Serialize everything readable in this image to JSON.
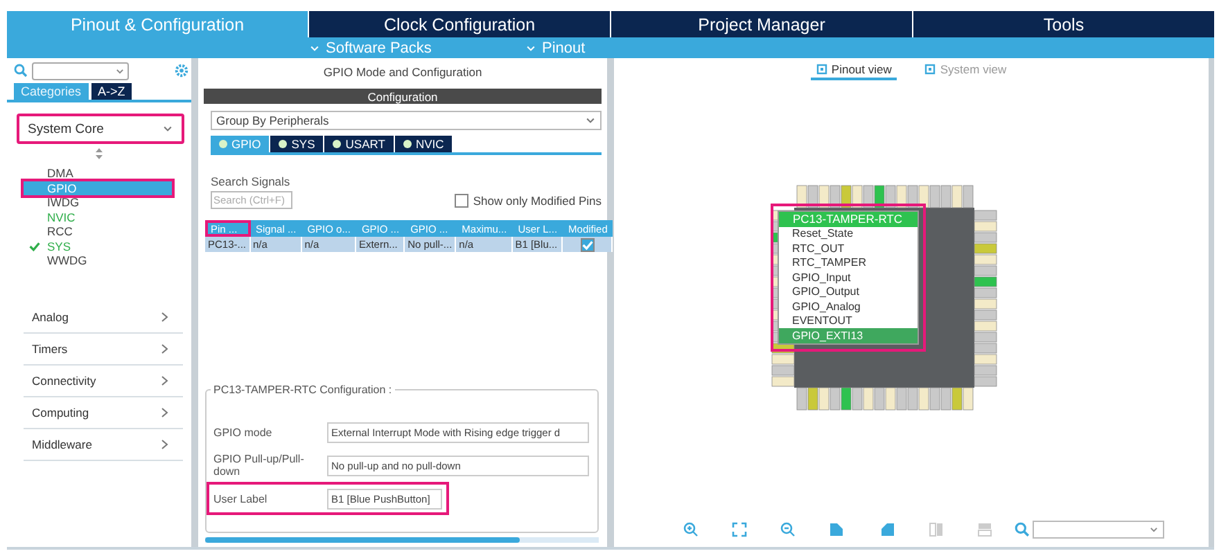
{
  "main_tabs": [
    {
      "label": "Pinout & Configuration",
      "selected": true
    },
    {
      "label": "Clock Configuration",
      "selected": false
    },
    {
      "label": "Project Manager",
      "selected": false
    },
    {
      "label": "Tools",
      "selected": false
    }
  ],
  "sub_menus": [
    {
      "label": "Software Packs"
    },
    {
      "label": "Pinout"
    }
  ],
  "sidebar": {
    "view_tabs": [
      {
        "label": "Categories",
        "selected": true
      },
      {
        "label": "A->Z",
        "selected": false
      }
    ],
    "categories": [
      {
        "label": "System Core",
        "expanded": true,
        "highlighted": true,
        "children": [
          {
            "label": "DMA",
            "selected": false,
            "configured": false,
            "checked": false,
            "highlighted": false
          },
          {
            "label": "GPIO",
            "selected": true,
            "configured": false,
            "checked": false,
            "highlighted": true
          },
          {
            "label": "IWDG",
            "selected": false,
            "configured": false,
            "checked": false,
            "highlighted": false
          },
          {
            "label": "NVIC",
            "selected": false,
            "configured": true,
            "checked": false,
            "highlighted": false
          },
          {
            "label": "RCC",
            "selected": false,
            "configured": false,
            "checked": false,
            "highlighted": false
          },
          {
            "label": "SYS",
            "selected": false,
            "configured": true,
            "checked": true,
            "highlighted": false
          },
          {
            "label": "WWDG",
            "selected": false,
            "configured": false,
            "checked": false,
            "highlighted": false
          }
        ]
      },
      {
        "label": "Analog",
        "expanded": false,
        "highlighted": false
      },
      {
        "label": "Timers",
        "expanded": false,
        "highlighted": false
      },
      {
        "label": "Connectivity",
        "expanded": false,
        "highlighted": false
      },
      {
        "label": "Computing",
        "expanded": false,
        "highlighted": false
      },
      {
        "label": "Middleware",
        "expanded": false,
        "highlighted": false
      }
    ]
  },
  "mode_panel": {
    "title": "GPIO Mode and Configuration",
    "section": "Configuration",
    "group_select": "Group By Peripherals",
    "mode_tabs": [
      {
        "label": "GPIO",
        "selected": true
      },
      {
        "label": "SYS",
        "selected": false
      },
      {
        "label": "USART",
        "selected": false
      },
      {
        "label": "NVIC",
        "selected": false
      }
    ],
    "search_label": "Search Signals",
    "search": {
      "placeholder": "Search (Ctrl+F)"
    },
    "modified_only": {
      "label": "Show only Modified Pins",
      "checked": false
    },
    "table": {
      "columns": [
        {
          "label": "Pin ...",
          "highlighted": true
        },
        {
          "label": "Signal ...",
          "highlighted": false
        },
        {
          "label": "GPIO o...",
          "highlighted": false
        },
        {
          "label": "GPIO ...",
          "highlighted": false
        },
        {
          "label": "GPIO ...",
          "highlighted": false
        },
        {
          "label": "Maximu...",
          "highlighted": false
        },
        {
          "label": "User L...",
          "highlighted": false
        },
        {
          "label": "Modified",
          "highlighted": false
        }
      ],
      "rows": [
        {
          "cells": [
            "PC13-...",
            "n/a",
            "n/a",
            "Extern...",
            "No pull-...",
            "n/a",
            "B1 [Blu..."
          ],
          "modified": true,
          "selected": true
        }
      ]
    },
    "config_title": "PC13-TAMPER-RTC Configuration :",
    "fields": [
      {
        "label": "GPIO mode",
        "value": "External Interrupt Mode with Rising edge trigger d",
        "highlighted": false
      },
      {
        "label": "GPIO Pull-up/Pull-down",
        "value": "No pull-up and no pull-down",
        "highlighted": false
      },
      {
        "label": "User Label",
        "value": "B1 [Blue PushButton]",
        "highlighted": true
      }
    ]
  },
  "pinout_panel": {
    "view_tabs": [
      {
        "label": "Pinout view",
        "selected": true
      },
      {
        "label": "System view",
        "selected": false
      }
    ],
    "pin_menu": {
      "title": "PC13-TAMPER-RTC",
      "highlighted": true,
      "options": [
        {
          "label": "Reset_State",
          "selected": false
        },
        {
          "label": "RTC_OUT",
          "selected": false
        },
        {
          "label": "RTC_TAMPER",
          "selected": false
        },
        {
          "label": "GPIO_Input",
          "selected": false
        },
        {
          "label": "GPIO_Output",
          "selected": false
        },
        {
          "label": "GPIO_Analog",
          "selected": false
        },
        {
          "label": "EVENTOUT",
          "selected": false
        },
        {
          "label": "GPIO_EXTI13",
          "selected": true
        }
      ]
    }
  }
}
